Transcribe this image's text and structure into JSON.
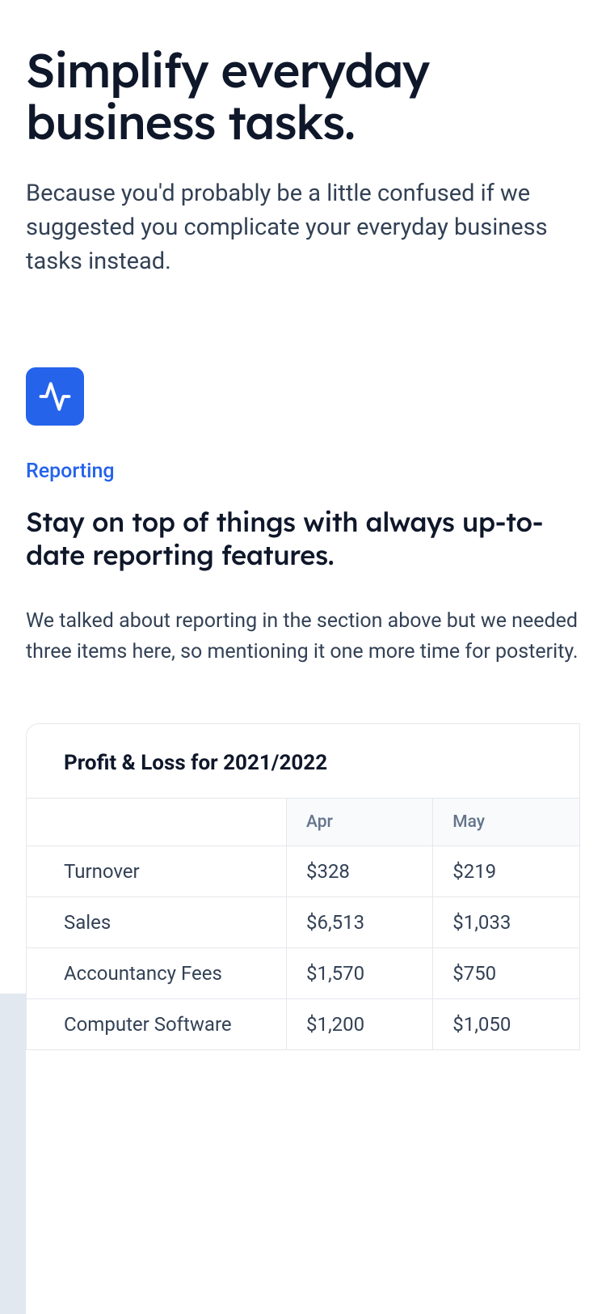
{
  "hero": {
    "title": "Simplify everyday business tasks.",
    "subtitle": "Because you'd probably be a little confused if we suggested you complicate your everyday business tasks instead."
  },
  "feature": {
    "label": "Reporting",
    "title": "Stay on top of things with always up-to-date reporting features.",
    "description": "We talked about reporting in the section above but we needed three items here, so mentioning it one more time for posterity."
  },
  "table": {
    "title": "Profit & Loss for 2021/2022",
    "columns": [
      "",
      "Apr",
      "May"
    ],
    "rows": [
      {
        "label": "Turnover",
        "apr": "$328",
        "may": "$219"
      },
      {
        "label": "Sales",
        "apr": "$6,513",
        "may": "$1,033"
      },
      {
        "label": "Accountancy Fees",
        "apr": "$1,570",
        "may": "$750"
      },
      {
        "label": "Computer Software",
        "apr": "$1,200",
        "may": "$1,050"
      }
    ]
  }
}
